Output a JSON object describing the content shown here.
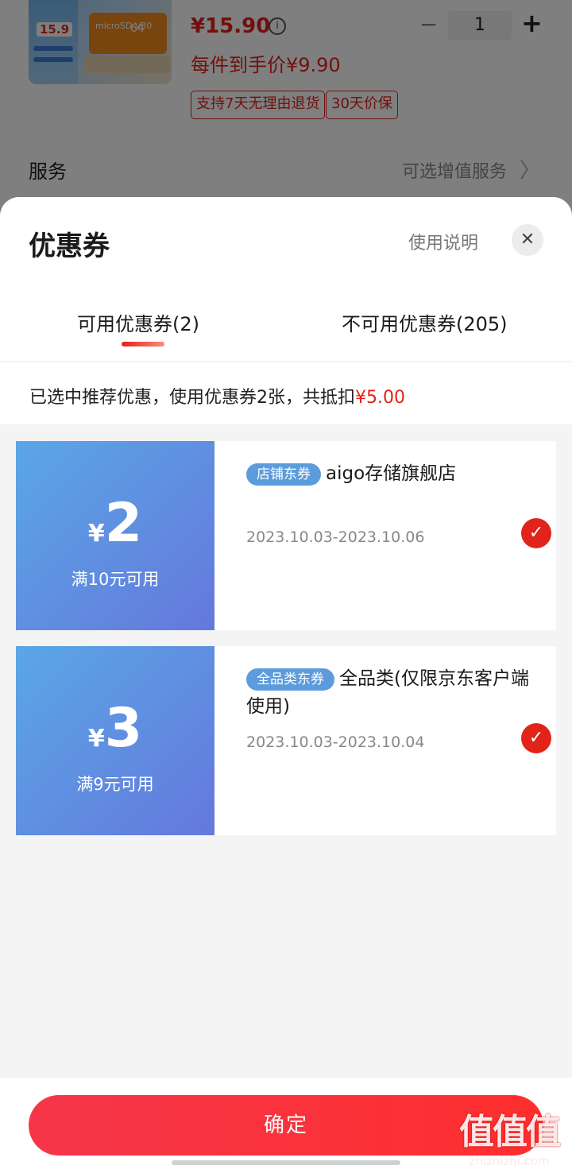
{
  "product": {
    "thumb_price": "15.9",
    "thumb_gb": "64",
    "thumb_card_text": "microSD V30",
    "price": "¥15.90",
    "info_icon": "i",
    "qty_minus": "−",
    "quantity": "1",
    "qty_plus": "+",
    "hand_price": "每件到手价¥9.90",
    "tags": [
      "支持7天无理由退货",
      "30天价保"
    ],
    "service_label": "服务",
    "service_value": "可选增值服务",
    "chevron": "〉"
  },
  "sheet": {
    "title": "优惠券",
    "help": "使用说明",
    "close": "✕",
    "tabs": {
      "available": "可用优惠券(2)",
      "unavailable": "不可用优惠券(205)"
    },
    "summary_prefix": "已选中推荐优惠，使用优惠券2张，共抵扣",
    "summary_amount": "¥5.00"
  },
  "coupons": [
    {
      "currency": "¥",
      "amount": "2",
      "condition": "满10元可用",
      "badge": "店铺东券",
      "name": "aigo存储旗舰店",
      "date": "2023.10.03-2023.10.06",
      "check": "✓"
    },
    {
      "currency": "¥",
      "amount": "3",
      "condition": "满9元可用",
      "badge": "全品类东券",
      "name": "全品类(仅限京东客户端使用)",
      "date": "2023.10.03-2023.10.04",
      "check": "✓"
    }
  ],
  "footer": {
    "confirm": "确定"
  },
  "watermark": {
    "main": "值值值",
    "sub": "zhizhizhi.com"
  },
  "colors": {
    "accent_red": "#e2231a",
    "coupon_gradient_start": "#5aa7e6",
    "coupon_gradient_end": "#6578dc",
    "badge_blue": "#5c9cdd"
  }
}
